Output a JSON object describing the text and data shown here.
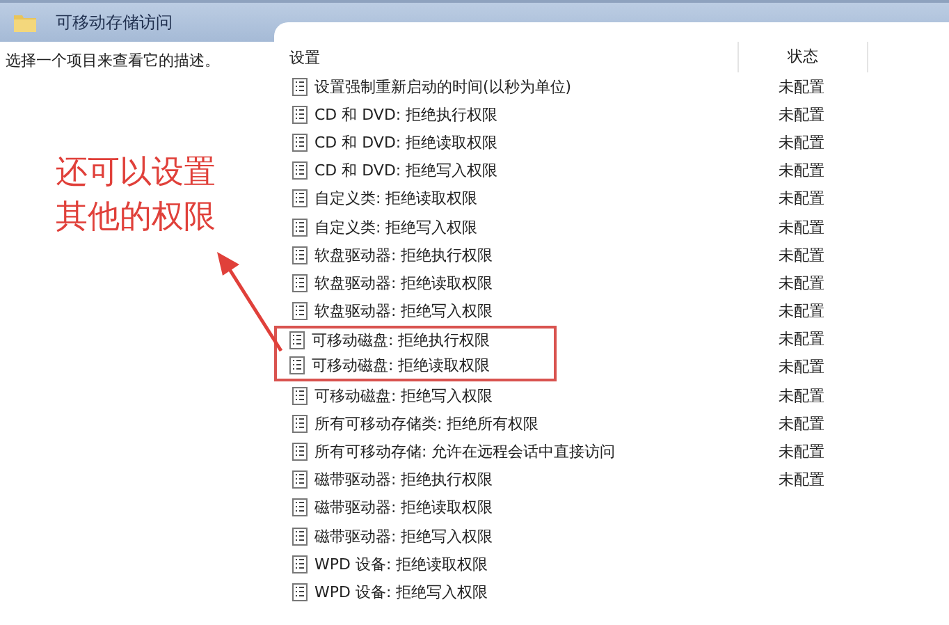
{
  "window": {
    "title": "可移动存储访问"
  },
  "description": "选择一个项目来查看它的描述。",
  "table": {
    "columns": [
      "设置",
      "状态"
    ],
    "rows": [
      {
        "setting": "设置强制重新启动的时间(以秒为单位)",
        "status": "未配置",
        "boxed": false
      },
      {
        "setting": "CD 和 DVD: 拒绝执行权限",
        "status": "未配置",
        "boxed": false
      },
      {
        "setting": "CD 和 DVD: 拒绝读取权限",
        "status": "未配置",
        "boxed": false
      },
      {
        "setting": "CD 和 DVD: 拒绝写入权限",
        "status": "未配置",
        "boxed": false
      },
      {
        "setting": "自定义类: 拒绝读取权限",
        "status": "未配置",
        "boxed": false
      },
      {
        "setting": "自定义类: 拒绝写入权限",
        "status": "未配置",
        "boxed": false
      },
      {
        "setting": "软盘驱动器: 拒绝执行权限",
        "status": "未配置",
        "boxed": false
      },
      {
        "setting": "软盘驱动器: 拒绝读取权限",
        "status": "未配置",
        "boxed": false
      },
      {
        "setting": "软盘驱动器: 拒绝写入权限",
        "status": "未配置",
        "boxed": false
      },
      {
        "setting": "可移动磁盘: 拒绝执行权限",
        "status": "未配置",
        "boxed": true
      },
      {
        "setting": "可移动磁盘: 拒绝读取权限",
        "status": "未配置",
        "boxed": true
      },
      {
        "setting": "可移动磁盘: 拒绝写入权限",
        "status": "未配置",
        "boxed": false
      },
      {
        "setting": "所有可移动存储类: 拒绝所有权限",
        "status": "未配置",
        "boxed": false
      },
      {
        "setting": "所有可移动存储: 允许在远程会话中直接访问",
        "status": "未配置",
        "boxed": false
      },
      {
        "setting": "磁带驱动器: 拒绝执行权限",
        "status": "未配置",
        "boxed": false
      },
      {
        "setting": "磁带驱动器: 拒绝读取权限",
        "boxed": false
      },
      {
        "setting": "磁带驱动器: 拒绝写入权限",
        "boxed": false
      },
      {
        "setting": "WPD 设备: 拒绝读取权限",
        "boxed": false
      },
      {
        "setting": "WPD 设备: 拒绝写入权限",
        "boxed": false
      }
    ]
  },
  "annotation": {
    "lines": [
      "还可以设置",
      "其他的权限"
    ]
  }
}
